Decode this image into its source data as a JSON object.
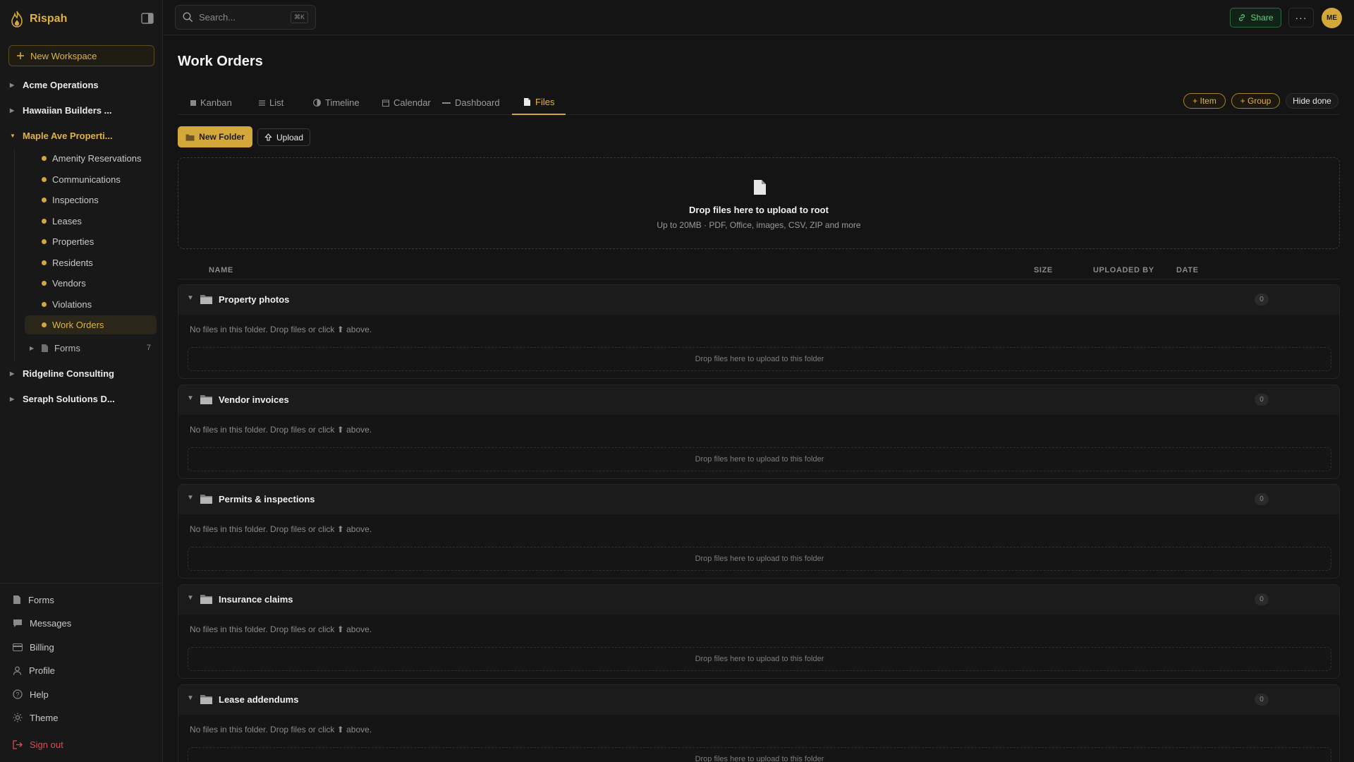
{
  "app": {
    "name": "Rispah"
  },
  "sidebar": {
    "new_workspace": "New Workspace",
    "workspaces": [
      {
        "label": "Acme Operations",
        "expanded": false
      },
      {
        "label": "Hawaiian Builders ...",
        "expanded": false
      },
      {
        "label": "Maple Ave Properti...",
        "expanded": true
      },
      {
        "label": "Ridgeline Consulting",
        "expanded": false
      },
      {
        "label": "Seraph Solutions D...",
        "expanded": false
      }
    ],
    "boards": [
      "Amenity Reservations",
      "Communications",
      "Inspections",
      "Leases",
      "Properties",
      "Residents",
      "Vendors",
      "Violations",
      "Work Orders"
    ],
    "active_board": "Work Orders",
    "forms_sub": {
      "label": "Forms",
      "count": "7"
    },
    "bottom_nav": [
      {
        "label": "Forms",
        "icon": "document-icon"
      },
      {
        "label": "Messages",
        "icon": "chat-icon"
      },
      {
        "label": "Billing",
        "icon": "card-icon"
      },
      {
        "label": "Profile",
        "icon": "user-icon"
      },
      {
        "label": "Help",
        "icon": "help-icon"
      },
      {
        "label": "Theme",
        "icon": "sun-icon"
      },
      {
        "label": "Sign out",
        "icon": "sign-out-icon"
      }
    ]
  },
  "topbar": {
    "search_placeholder": "Search...",
    "search_shortcut": "⌘K",
    "share": "Share",
    "more": "···",
    "avatar": "ME"
  },
  "main": {
    "title": "Work Orders",
    "tabs": [
      {
        "label": "Kanban",
        "icon": "kanban-icon"
      },
      {
        "label": "List",
        "icon": "list-icon"
      },
      {
        "label": "Timeline",
        "icon": "timeline-icon"
      },
      {
        "label": "Calendar",
        "icon": "calendar-icon"
      },
      {
        "label": "Dashboard",
        "icon": "dashboard-icon"
      },
      {
        "label": "Files",
        "icon": "file-icon"
      }
    ],
    "active_tab": "Files",
    "actions": {
      "add_item": "+ Item",
      "add_group": "+ Group",
      "hide_done": "Hide done"
    },
    "new_folder": "New Folder",
    "upload": "Upload",
    "dropzone": {
      "title": "Drop files here to upload to root",
      "subtitle": "Up to 20MB · PDF, Office, images, CSV, ZIP and more"
    },
    "columns": {
      "name": "NAME",
      "size": "SIZE",
      "uploaded_by": "UPLOADED BY",
      "date": "DATE"
    },
    "folders": [
      {
        "name": "Property photos",
        "count": "0",
        "empty": "No files in this folder. Drop files or click ⬆ above.",
        "drop": "Drop files here to upload to this folder"
      },
      {
        "name": "Vendor invoices",
        "count": "0",
        "empty": "No files in this folder. Drop files or click ⬆ above.",
        "drop": "Drop files here to upload to this folder"
      },
      {
        "name": "Permits & inspections",
        "count": "0",
        "empty": "No files in this folder. Drop files or click ⬆ above.",
        "drop": "Drop files here to upload to this folder"
      },
      {
        "name": "Insurance claims",
        "count": "0",
        "empty": "No files in this folder. Drop files or click ⬆ above.",
        "drop": "Drop files here to upload to this folder"
      },
      {
        "name": "Lease addendums",
        "count": "0",
        "empty": "No files in this folder. Drop files or click ⬆ above.",
        "drop": "Drop files here to upload to this folder"
      }
    ]
  },
  "colors": {
    "accent": "#d4a73a",
    "share_green": "#5fd17a",
    "danger": "#e5484d",
    "background": "#141414"
  }
}
